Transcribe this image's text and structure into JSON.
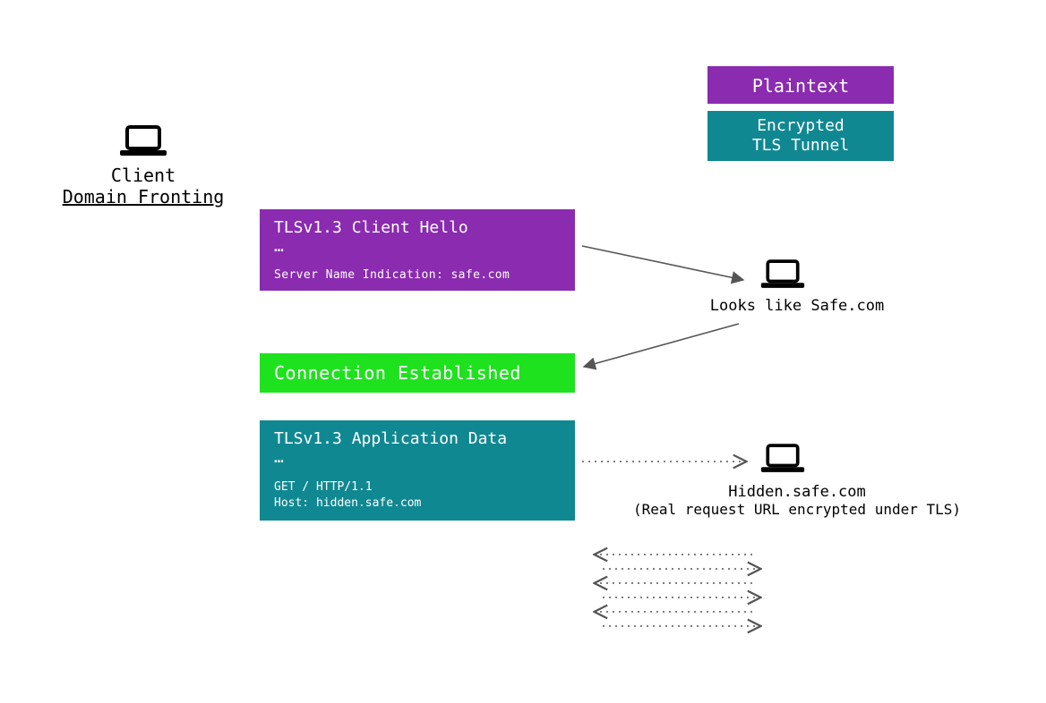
{
  "legend": {
    "plaintext": "Plaintext",
    "encrypted_l1": "Encrypted",
    "encrypted_l2": "TLS Tunnel"
  },
  "client": {
    "line1": "Client",
    "line2": "Domain Fronting"
  },
  "hello": {
    "title": "TLSv1.3 Client Hello",
    "dots": "…",
    "sni": "Server Name Indication: safe.com"
  },
  "connection": {
    "text": "Connection Established"
  },
  "appdata": {
    "title": "TLSv1.3 Application Data",
    "dots": "…",
    "get": "GET / HTTP/1.1",
    "host": "Host: hidden.safe.com"
  },
  "safe_node": {
    "label": "Looks like Safe.com"
  },
  "hidden_node": {
    "label": "Hidden.safe.com",
    "sub": "(Real request URL encrypted under TLS)"
  },
  "colors": {
    "purple": "#8a2bb0",
    "teal": "#108892",
    "green": "#1ee21e",
    "arrow": "#555"
  }
}
